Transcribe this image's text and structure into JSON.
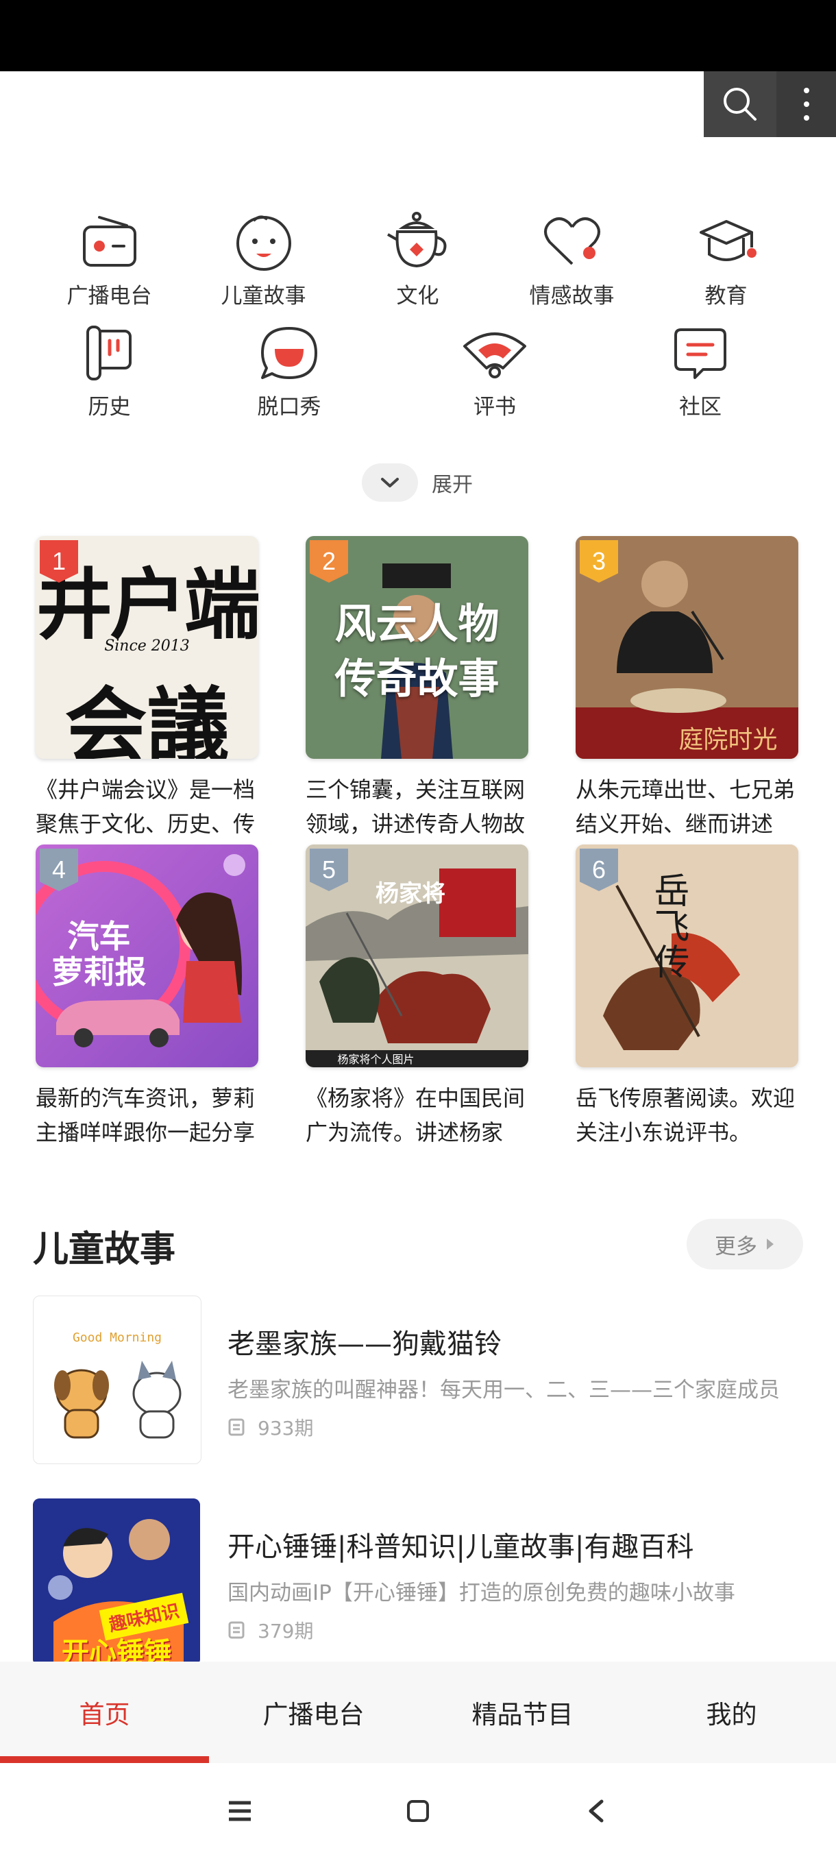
{
  "categories_row1": [
    {
      "label": "广播电台",
      "icon": "radio-icon"
    },
    {
      "label": "儿童故事",
      "icon": "child-face-icon"
    },
    {
      "label": "文化",
      "icon": "teapot-icon"
    },
    {
      "label": "情感故事",
      "icon": "heart-icon"
    },
    {
      "label": "教育",
      "icon": "graduation-cap-icon"
    }
  ],
  "categories_row2": [
    {
      "label": "历史",
      "icon": "scroll-icon"
    },
    {
      "label": "脱口秀",
      "icon": "chat-bubble-icon"
    },
    {
      "label": "评书",
      "icon": "folding-fan-icon"
    },
    {
      "label": "社区",
      "icon": "message-icon"
    }
  ],
  "expand_label": "展开",
  "rank_cards": [
    {
      "rank": "1",
      "desc": "《井户端会议》是一档聚焦于文化、历史、传播的深度播客节目"
    },
    {
      "rank": "2",
      "desc": "三个锦囊，关注互联网领域，讲述传奇人物故事"
    },
    {
      "rank": "3",
      "desc": "从朱元璋出世、七兄弟结义开始、继而讲述"
    },
    {
      "rank": "4",
      "desc": "最新的汽车资讯，萝莉主播咩咩跟你一起分享"
    },
    {
      "rank": "5",
      "desc": "《杨家将》在中国民间广为流传。讲述杨家"
    },
    {
      "rank": "6",
      "desc": "岳飞传原著阅读。欢迎关注小东说评书。"
    }
  ],
  "cover_text": {
    "c1_line1": "井户端",
    "c1_line2": "会議",
    "c1_small": "Since 2013",
    "c2_line1": "风云人物",
    "c2_line2": "传奇故事",
    "c3_banner": "庭院时光",
    "c4_line1": "汽车",
    "c4_line2": "萝莉报",
    "c5_title": "杨家将",
    "c5_caption": "杨家将个人图片",
    "c6_title": "岳飞传"
  },
  "section": {
    "title": "儿童故事",
    "more": "更多"
  },
  "list_items": [
    {
      "title": "老墨家族——狗戴猫铃",
      "subtitle": "老墨家族的叫醒神器！每天用一、二、三——三个家庭成员",
      "count": "933期",
      "cover_text": "Good Morning"
    },
    {
      "title": "开心锤锤|科普知识|儿童故事|有趣百科",
      "subtitle": "国内动画IP【开心锤锤】打造的原创免费的趣味小故事",
      "count": "379期",
      "cover_text": "开心锤锤",
      "cover_badge": "趣味知识"
    }
  ],
  "bottom_nav": [
    "首页",
    "广播电台",
    "精品节目",
    "我的"
  ],
  "colors": {
    "accent": "#d9342b",
    "rank1": "#e8453c",
    "rank2": "#f08a3c",
    "rank3": "#f5b12e",
    "rank_other": "#8fa0b3"
  }
}
